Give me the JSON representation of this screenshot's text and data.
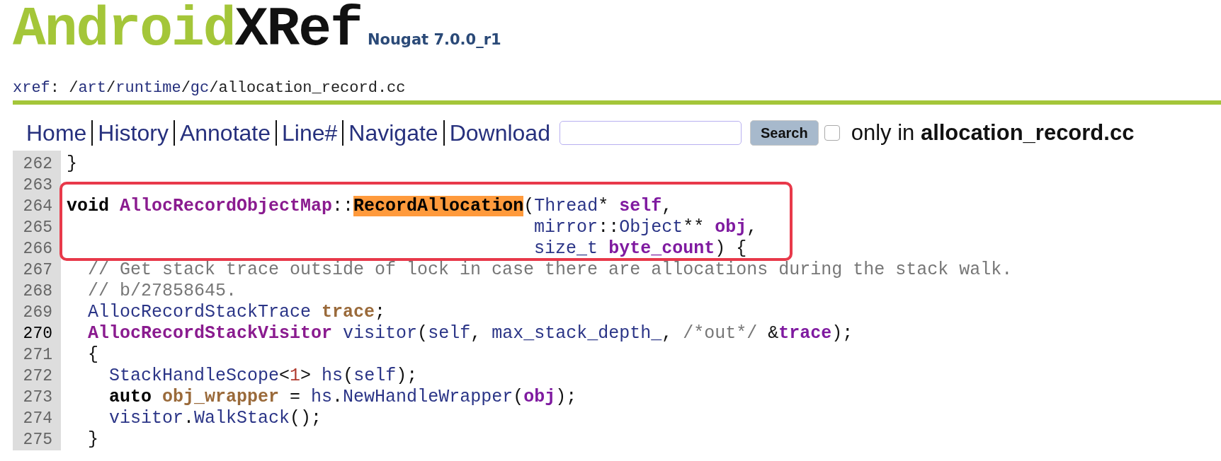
{
  "logo": {
    "first": "Android",
    "second": "XRef"
  },
  "version": "Nougat 7.0.0_r1",
  "path": [
    {
      "text": "xref",
      "link": true
    },
    {
      "text": ": /",
      "link": false
    },
    {
      "text": "art",
      "link": true
    },
    {
      "text": "/",
      "link": false
    },
    {
      "text": "runtime",
      "link": true
    },
    {
      "text": "/",
      "link": false
    },
    {
      "text": "gc",
      "link": true
    },
    {
      "text": "/",
      "link": false
    },
    {
      "text": "allocation_record.cc",
      "link": false
    }
  ],
  "nav": [
    "Home",
    "History",
    "Annotate",
    "Line#",
    "Navigate",
    "Download"
  ],
  "search": {
    "button": "Search",
    "only_in_checked": false,
    "only_in_label": "only in **allocation_record.cc**"
  },
  "lines": [
    {
      "number": "262",
      "current": false,
      "framed": false,
      "tokens": [
        {
          "text": "}",
          "kind": "plain"
        }
      ]
    },
    {
      "number": "263",
      "current": false,
      "framed": false
    },
    {
      "number": "264",
      "current": false,
      "framed": true,
      "tokens": [
        {
          "text": "void ",
          "kind": "keyword"
        },
        {
          "text": "AllocRecordObjectMap",
          "kind": "type"
        },
        {
          "text": "::",
          "kind": "plain"
        },
        {
          "text": "RecordAllocation",
          "kind": "match"
        },
        {
          "text": "(",
          "kind": "plain"
        },
        {
          "text": "Thread",
          "kind": "ident"
        },
        {
          "text": "* ",
          "kind": "plain"
        },
        {
          "text": "self",
          "kind": "param"
        },
        {
          "text": ",",
          "kind": "plain"
        }
      ]
    },
    {
      "number": "265",
      "current": false,
      "framed": true,
      "tokens": [
        {
          "text": "                                            mirror",
          "kind": "ident"
        },
        {
          "text": "::",
          "kind": "plain"
        },
        {
          "text": "Object",
          "kind": "ident"
        },
        {
          "text": "** ",
          "kind": "plain"
        },
        {
          "text": "obj",
          "kind": "param"
        },
        {
          "text": ",",
          "kind": "plain"
        }
      ]
    },
    {
      "number": "266",
      "current": false,
      "framed": true,
      "tokens": [
        {
          "text": "                                            size_t ",
          "kind": "ident"
        },
        {
          "text": "byte_count",
          "kind": "param"
        },
        {
          "text": ") {",
          "kind": "plain"
        }
      ]
    },
    {
      "number": "267",
      "current": false,
      "framed": false,
      "tokens": [
        {
          "text": "  // Get stack trace outside of lock in case there are allocations during the stack walk.",
          "kind": "comment"
        }
      ]
    },
    {
      "number": "268",
      "current": false,
      "framed": false,
      "tokens": [
        {
          "text": "  // b/27858645.",
          "kind": "comment"
        }
      ]
    },
    {
      "number": "269",
      "current": false,
      "framed": false,
      "tokens": [
        {
          "text": "  AllocRecordStackTrace ",
          "kind": "ident"
        },
        {
          "text": "trace",
          "kind": "local"
        },
        {
          "text": ";",
          "kind": "plain"
        }
      ]
    },
    {
      "number": "270",
      "current": true,
      "framed": false,
      "tokens": [
        {
          "text": "  AllocRecordStackVisitor ",
          "kind": "type"
        },
        {
          "text": "visitor",
          "kind": "ident"
        },
        {
          "text": "(",
          "kind": "plain"
        },
        {
          "text": "self",
          "kind": "ident"
        },
        {
          "text": ", ",
          "kind": "plain"
        },
        {
          "text": "max_stack_depth_",
          "kind": "ident"
        },
        {
          "text": ", ",
          "kind": "plain"
        },
        {
          "text": "/*out*/",
          "kind": "comment"
        },
        {
          "text": " &",
          "kind": "plain"
        },
        {
          "text": "trace",
          "kind": "param"
        },
        {
          "text": ");",
          "kind": "plain"
        }
      ]
    },
    {
      "number": "271",
      "current": false,
      "framed": false,
      "tokens": [
        {
          "text": "  {",
          "kind": "plain"
        }
      ]
    },
    {
      "number": "272",
      "current": false,
      "framed": false,
      "tokens": [
        {
          "text": "    StackHandleScope",
          "kind": "ident"
        },
        {
          "text": "<",
          "kind": "plain"
        },
        {
          "text": "1",
          "kind": "number"
        },
        {
          "text": "> ",
          "kind": "plain"
        },
        {
          "text": "hs",
          "kind": "ident"
        },
        {
          "text": "(",
          "kind": "plain"
        },
        {
          "text": "self",
          "kind": "ident"
        },
        {
          "text": ");",
          "kind": "plain"
        }
      ]
    },
    {
      "number": "273",
      "current": false,
      "framed": false,
      "tokens": [
        {
          "text": "    auto ",
          "kind": "keyword"
        },
        {
          "text": "obj_wrapper",
          "kind": "local"
        },
        {
          "text": " = ",
          "kind": "plain"
        },
        {
          "text": "hs",
          "kind": "ident"
        },
        {
          "text": ".",
          "kind": "plain"
        },
        {
          "text": "NewHandleWrapper",
          "kind": "ident"
        },
        {
          "text": "(",
          "kind": "plain"
        },
        {
          "text": "obj",
          "kind": "param"
        },
        {
          "text": ");",
          "kind": "plain"
        }
      ]
    },
    {
      "number": "274",
      "current": false,
      "framed": false,
      "tokens": [
        {
          "text": "    visitor",
          "kind": "ident"
        },
        {
          "text": ".",
          "kind": "plain"
        },
        {
          "text": "WalkStack",
          "kind": "ident"
        },
        {
          "text": "();",
          "kind": "plain"
        }
      ]
    },
    {
      "number": "275",
      "current": false,
      "framed": false,
      "tokens": [
        {
          "text": "  }",
          "kind": "plain"
        }
      ]
    }
  ]
}
